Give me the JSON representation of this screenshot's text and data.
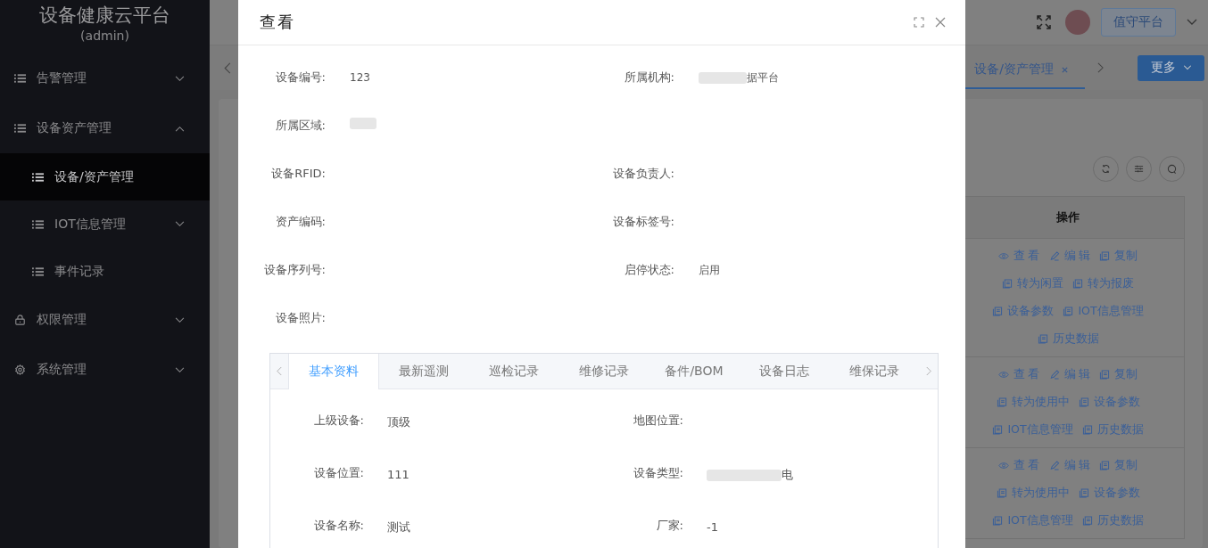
{
  "sidebar": {
    "title": "设备健康云平台",
    "subtitle": "(admin)",
    "items": [
      {
        "label": "告警管理",
        "kind": "list",
        "expanded": false,
        "selected": false
      },
      {
        "label": "设备资产管理",
        "kind": "list",
        "expanded": true,
        "selected": false,
        "children": [
          {
            "label": "设备/资产管理",
            "kind": "list",
            "selected": true
          },
          {
            "label": "IOT信息管理",
            "kind": "list",
            "expanded": false,
            "selected": false
          },
          {
            "label": "事件记录",
            "kind": "list",
            "selected": false
          }
        ]
      },
      {
        "label": "权限管理",
        "kind": "lock",
        "expanded": false,
        "selected": false
      },
      {
        "label": "系统管理",
        "kind": "gear",
        "expanded": false,
        "selected": false
      }
    ]
  },
  "header": {
    "user_button": "值守平台"
  },
  "page_tabs": [
    {
      "label": "设备/资产管理",
      "selected": true
    }
  ],
  "more_button": "更多",
  "table": {
    "column": "操作",
    "rows": [
      {
        "lines": [
          [
            {
              "label": "查 看",
              "kind": "view"
            },
            {
              "label": "编 辑",
              "kind": "edit"
            },
            {
              "label": "复制",
              "kind": "doc"
            }
          ],
          [
            {
              "label": "转为闲置",
              "kind": "doc"
            },
            {
              "label": "转为报废",
              "kind": "doc"
            }
          ],
          [
            {
              "label": "设备参数",
              "kind": "doc"
            },
            {
              "label": "IOT信息管理",
              "kind": "doc"
            }
          ],
          [
            {
              "label": "历史数据",
              "kind": "doc"
            }
          ]
        ]
      },
      {
        "lines": [
          [
            {
              "label": "查 看",
              "kind": "view"
            },
            {
              "label": "编 辑",
              "kind": "edit"
            },
            {
              "label": "复制",
              "kind": "doc"
            }
          ],
          [
            {
              "label": "转为使用中",
              "kind": "doc"
            },
            {
              "label": "设备参数",
              "kind": "doc"
            }
          ],
          [
            {
              "label": "IOT信息管理",
              "kind": "doc"
            },
            {
              "label": "历史数据",
              "kind": "doc"
            }
          ]
        ]
      },
      {
        "lines": [
          [
            {
              "label": "查 看",
              "kind": "view"
            },
            {
              "label": "编 辑",
              "kind": "edit"
            },
            {
              "label": "复制",
              "kind": "doc"
            }
          ],
          [
            {
              "label": "转为使用中",
              "kind": "doc"
            },
            {
              "label": "设备参数",
              "kind": "doc"
            }
          ],
          [
            {
              "label": "IOT信息管理",
              "kind": "doc"
            },
            {
              "label": "历史数据",
              "kind": "doc"
            }
          ]
        ]
      }
    ]
  },
  "modal": {
    "title": "查看",
    "rows": [
      [
        {
          "label": "设备编号:",
          "value": "123"
        },
        {
          "label": "所属机构:",
          "value": "据平台",
          "redacted": true
        }
      ],
      [
        {
          "label": "所属区域:",
          "redacted": true
        }
      ],
      [
        {
          "label": "设备RFID:"
        },
        {
          "label": "设备负责人:"
        }
      ],
      [
        {
          "label": "资产编码:"
        },
        {
          "label": "设备标签号:"
        }
      ],
      [
        {
          "label": "设备序列号:"
        },
        {
          "label": "启停状态:",
          "value": "启用"
        }
      ],
      [
        {
          "label": "设备照片:"
        }
      ]
    ],
    "tabs": [
      {
        "label": "基本资料",
        "selected": true
      },
      {
        "label": "最新遥测",
        "selected": false
      },
      {
        "label": "巡检记录",
        "selected": false
      },
      {
        "label": "维修记录",
        "selected": false
      },
      {
        "label": "备件/BOM",
        "selected": false
      },
      {
        "label": "设备日志",
        "selected": false
      },
      {
        "label": "维保记录",
        "selected": false
      }
    ],
    "details": [
      [
        {
          "label": "上级设备:",
          "value": "顶级"
        },
        {
          "label": "地图位置:"
        }
      ],
      [
        {
          "label": "设备位置:",
          "value": "111"
        },
        {
          "label": "设备类型:",
          "value": "电",
          "redacted": true
        }
      ],
      [
        {
          "label": "设备名称:",
          "value": "测试"
        },
        {
          "label": "厂家:",
          "value": "-1"
        }
      ]
    ]
  }
}
